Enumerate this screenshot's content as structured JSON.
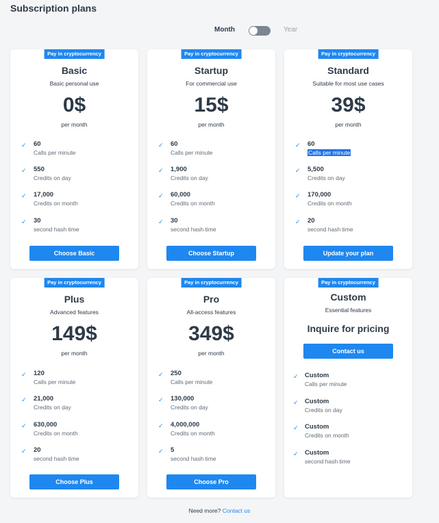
{
  "page": {
    "title": "Subscription plans"
  },
  "billing": {
    "month_label": "Month",
    "year_label": "Year"
  },
  "badge": "Pay in cryptocurrency",
  "plans": [
    {
      "name": "Basic",
      "subtitle": "Basic personal use",
      "price": "0$",
      "per": "per month",
      "features": [
        {
          "value": "60",
          "label": "Calls per minute"
        },
        {
          "value": "550",
          "label": "Credits on day"
        },
        {
          "value": "17,000",
          "label": "Credits on month"
        },
        {
          "value": "30",
          "label": "second hash time"
        }
      ],
      "cta": "Choose Basic"
    },
    {
      "name": "Startup",
      "subtitle": "For commercial use",
      "price": "15$",
      "per": "per month",
      "features": [
        {
          "value": "60",
          "label": "Calls per minute"
        },
        {
          "value": "1,900",
          "label": "Credits on day"
        },
        {
          "value": "60,000",
          "label": "Credits on month"
        },
        {
          "value": "30",
          "label": "second hash time"
        }
      ],
      "cta": "Choose Startup"
    },
    {
      "name": "Standard",
      "subtitle": "Suitable for most use cases",
      "price": "39$",
      "per": "per month",
      "features": [
        {
          "value": "60",
          "label": "Calls per minute"
        },
        {
          "value": "5,500",
          "label": "Credits on day"
        },
        {
          "value": "170,000",
          "label": "Credits on month"
        },
        {
          "value": "20",
          "label": "second hash time"
        }
      ],
      "cta": "Update your plan"
    },
    {
      "name": "Plus",
      "subtitle": "Advanced features",
      "price": "149$",
      "per": "per month",
      "features": [
        {
          "value": "120",
          "label": "Calls per minute"
        },
        {
          "value": "21,000",
          "label": "Credits on day"
        },
        {
          "value": "630,000",
          "label": "Credits on month"
        },
        {
          "value": "20",
          "label": "second hash time"
        }
      ],
      "cta": "Choose Plus"
    },
    {
      "name": "Pro",
      "subtitle": "All-access features",
      "price": "349$",
      "per": "per month",
      "features": [
        {
          "value": "250",
          "label": "Calls per minute"
        },
        {
          "value": "130,000",
          "label": "Credits on day"
        },
        {
          "value": "4,000,000",
          "label": "Credits on month"
        },
        {
          "value": "5",
          "label": "second hash time"
        }
      ],
      "cta": "Choose Pro"
    },
    {
      "name": "Custom",
      "subtitle": "Essential features",
      "pricing_text": "Inquire for pricing",
      "features": [
        {
          "value": "Custom",
          "label": "Calls per minute"
        },
        {
          "value": "Custom",
          "label": "Credits on day"
        },
        {
          "value": "Custom",
          "label": "Credits on month"
        },
        {
          "value": "Custom",
          "label": "second hash time"
        }
      ],
      "cta": "Contact us"
    }
  ],
  "footer": {
    "text": "Need more?",
    "link": "Contact us"
  },
  "colors": {
    "accent": "#1e88f0",
    "text": "#2e3a48",
    "background": "#f4f5f7",
    "selection": "#1f73e6"
  }
}
